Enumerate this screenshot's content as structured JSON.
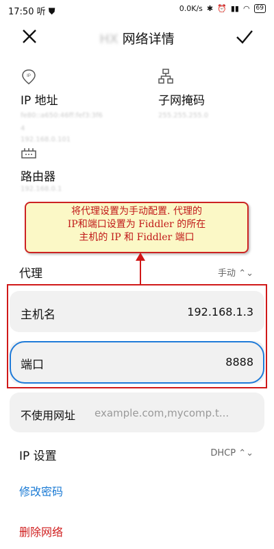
{
  "status_bar": {
    "time": "17:50",
    "left_badge": "听",
    "speed": "0.0K/s",
    "battery": "69"
  },
  "header": {
    "title_blurred": "HX",
    "title": "网络详情"
  },
  "info": {
    "ip_label": "IP 地址",
    "ip_value_line1": "fe80::a650:46ff:fef3:3f6",
    "ip_value_line2": "4",
    "ip_value_line3": "192.168.0.101",
    "subnet_label": "子网掩码",
    "subnet_value": "255.255.255.0",
    "router_label": "路由器",
    "router_value": "192.168.0.1"
  },
  "callout": {
    "line1": "将代理设置为手动配置. 代理的",
    "line2": "IP和端口设置为 Fiddler 的所在",
    "line3": "主机的 IP 和 Fiddler 端口"
  },
  "proxy": {
    "label": "代理",
    "mode": "手动",
    "hostname_label": "主机名",
    "hostname_value": "192.168.1.3",
    "port_label": "端口",
    "port_value": "8888",
    "bypass_label": "不使用网址",
    "bypass_placeholder": "example.com,mycomp.t..."
  },
  "ip_settings": {
    "label": "IP 设置",
    "mode": "DHCP"
  },
  "actions": {
    "modify_password": "修改密码",
    "delete_network": "删除网络"
  },
  "colors": {
    "link_blue": "#1a7ad4",
    "danger_red": "#d02020",
    "annotation_red": "#d01818",
    "annotation_blue": "#1e7ad8",
    "callout_bg": "#fbf8c6"
  }
}
